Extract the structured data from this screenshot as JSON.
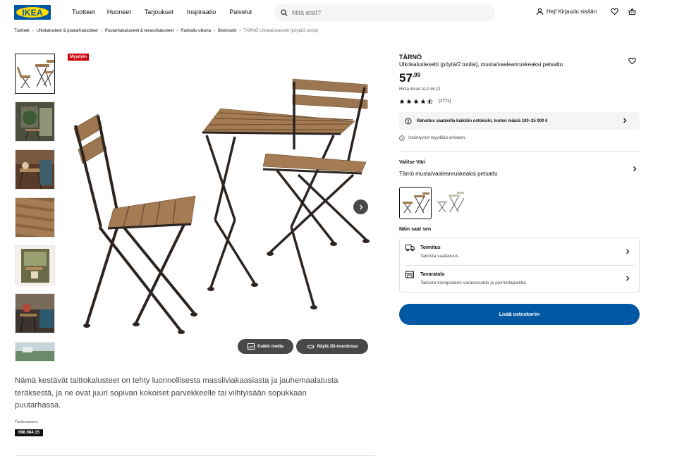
{
  "header": {
    "logo_text": "IKEA",
    "nav": [
      "Tuotteet",
      "Huoneet",
      "Tarjoukset",
      "Inspiraatio",
      "Palvelut"
    ],
    "search_placeholder": "Mitä etsit?",
    "login_label": "Hej! Kirjaudu sisään",
    "icons": [
      "search-icon",
      "user-icon",
      "heart-icon",
      "shopping-bag-icon"
    ]
  },
  "breadcrumb": {
    "items": [
      "Tuotteet",
      "Ulkokalusteet & puutarhatuotteet",
      "Puutarhakalusteet & terassikalusteet",
      "Ruokailu ulkona",
      "Bistrosetit"
    ],
    "current": "TÄRNÖ Ulkokalustesetti (pöytä/2 tuolia)"
  },
  "gallery": {
    "thumbnail_count": 7,
    "selected_index": 0,
    "badge": "Myydyin",
    "media_button": "Kaikki media",
    "view3d_button": "Näytä 3D-muodossa"
  },
  "product": {
    "name": "TÄRNÖ",
    "description": "Ulkokalustesetti (pöytä/2 tuolia), musta/vaaleanruskeaksi petsattu",
    "price_int": "57",
    "price_dec": ",99",
    "price_vat": "Hinta ilman ALV 46,21",
    "rating": 4.5,
    "review_count": "(1771)",
    "finance_text": "Rahoitus saatavilla kaikkiin ostoksiin, luoton määrä 100–25 000 €",
    "cushion_note": "Istuintyynyt myydään erikseen.",
    "color_label": "Valitse Väri",
    "color_value": "Tärnö musta/vaaleanruskeaksi petsattu",
    "howto_label": "Näin saat sen",
    "delivery_title": "Toimitus",
    "delivery_sub": "Tarkista saatavuus",
    "store_title": "Tavaratalo",
    "store_sub": "Tarkista toimipisteen varastosaldo ja poimintapaikka",
    "cart_button": "Lisää ostoskoriin",
    "long_description": "Nämä kestävät taittokalusteet on tehty luonnollisesta massiiviakaasiasta ja jauhemaalatusta teräksestä, ja ne ovat juuri sopivan kokoiset parvekkeelle tai viihtyisään sopukkaan puutarhassa.",
    "product_number_label": "Tuotenumero",
    "product_number": "698.984.15"
  },
  "colors": {
    "brand_blue": "#0058a3",
    "brand_yellow": "#ffdb00",
    "badge_red": "#cc0008",
    "wood": "#a07b52",
    "frame": "#2b2420"
  }
}
